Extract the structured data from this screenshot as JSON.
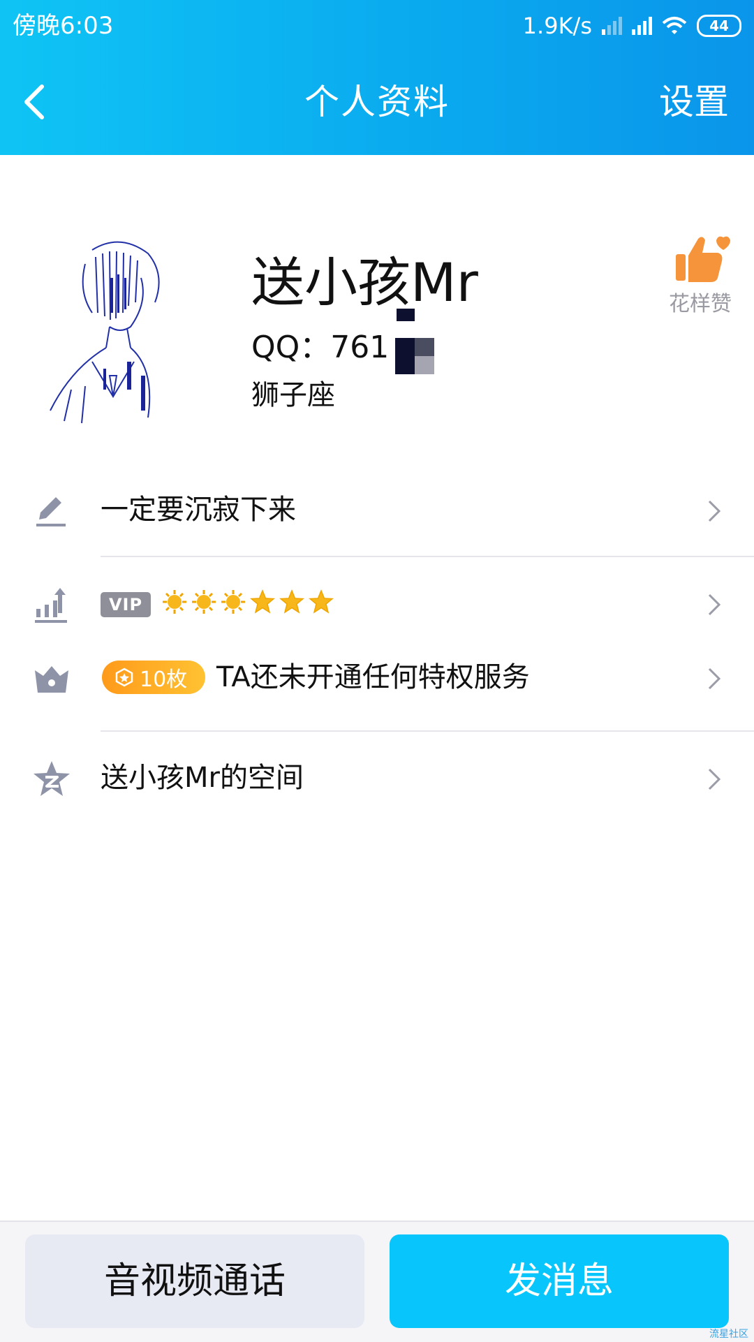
{
  "status_bar": {
    "time": "傍晚6:03",
    "speed": "1.9K/s",
    "battery": "44"
  },
  "nav": {
    "title": "个人资料",
    "settings_label": "设置"
  },
  "profile": {
    "name": "送小孩Mr",
    "qq": "QQ：761",
    "zodiac": "狮子座",
    "like_label": "花样赞"
  },
  "rows": {
    "signature": "一定要沉寂下来",
    "vip_badge": "VIP",
    "vip_stars": [
      "sun-icon",
      "sun-icon",
      "sun-icon",
      "star-icon",
      "star-icon",
      "star-icon"
    ],
    "coin_badge": "10枚",
    "privilege": "TA还未开通任何特权服务",
    "space": "送小孩Mr的空间"
  },
  "buttons": {
    "call": "音视频通话",
    "message": "发消息"
  },
  "watermark": "流星社区",
  "colors": {
    "header": "#0aa8ee",
    "primary_button": "#08c6fb",
    "secondary_button": "#e8eaf3",
    "like": "#f5943a",
    "coin": "#ff9a1a",
    "icon_gray": "#8e93a8"
  }
}
